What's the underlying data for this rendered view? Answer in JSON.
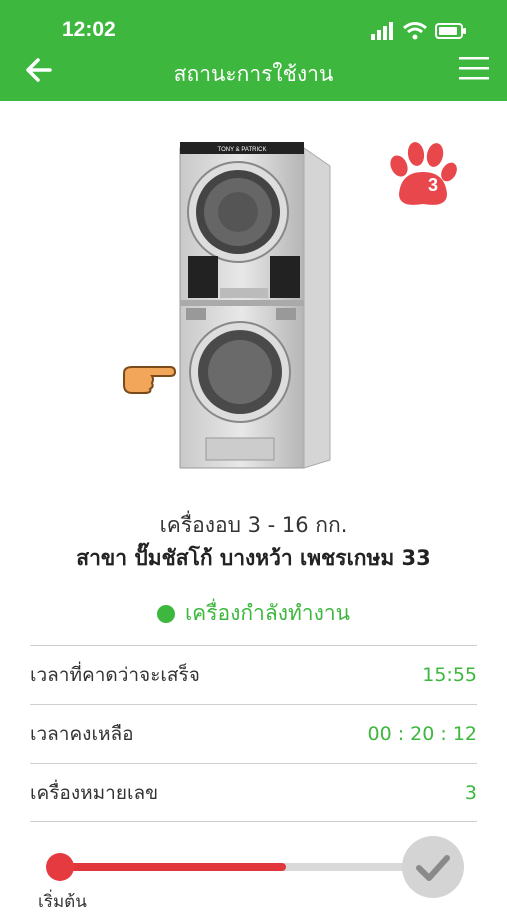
{
  "status_bar": {
    "time": "12:02"
  },
  "header": {
    "title": "สถานะการใช้งาน"
  },
  "machine": {
    "name": "เครื่องอบ 3 - 16 กก.",
    "branch": "สาขา ปั๊มชัสโก้ บางหว้า เพชรเกษม 33",
    "brand": "TONY & PATRICK",
    "badge_number": "3"
  },
  "status": {
    "label": "เครื่องกำลังทำงาน",
    "color": "#3db73d"
  },
  "details": [
    {
      "label": "เวลาที่คาดว่าจะเสร็จ",
      "value": "15:55"
    },
    {
      "label": "เวลาคงเหลือ",
      "value": "00 : 20 : 12"
    },
    {
      "label": "เครื่องหมายเลข",
      "value": "3"
    }
  ],
  "progress": {
    "fraction": 0.6,
    "start_label": "เริ่มต้น",
    "accent": "#e0363c"
  },
  "colors": {
    "primary": "#3db73d",
    "accent": "#e53b40"
  },
  "icons": {
    "back": "arrow-left-icon",
    "menu": "hamburger-menu-icon",
    "paw": "paw-icon",
    "hand": "pointing-hand-icon",
    "check": "check-icon"
  }
}
